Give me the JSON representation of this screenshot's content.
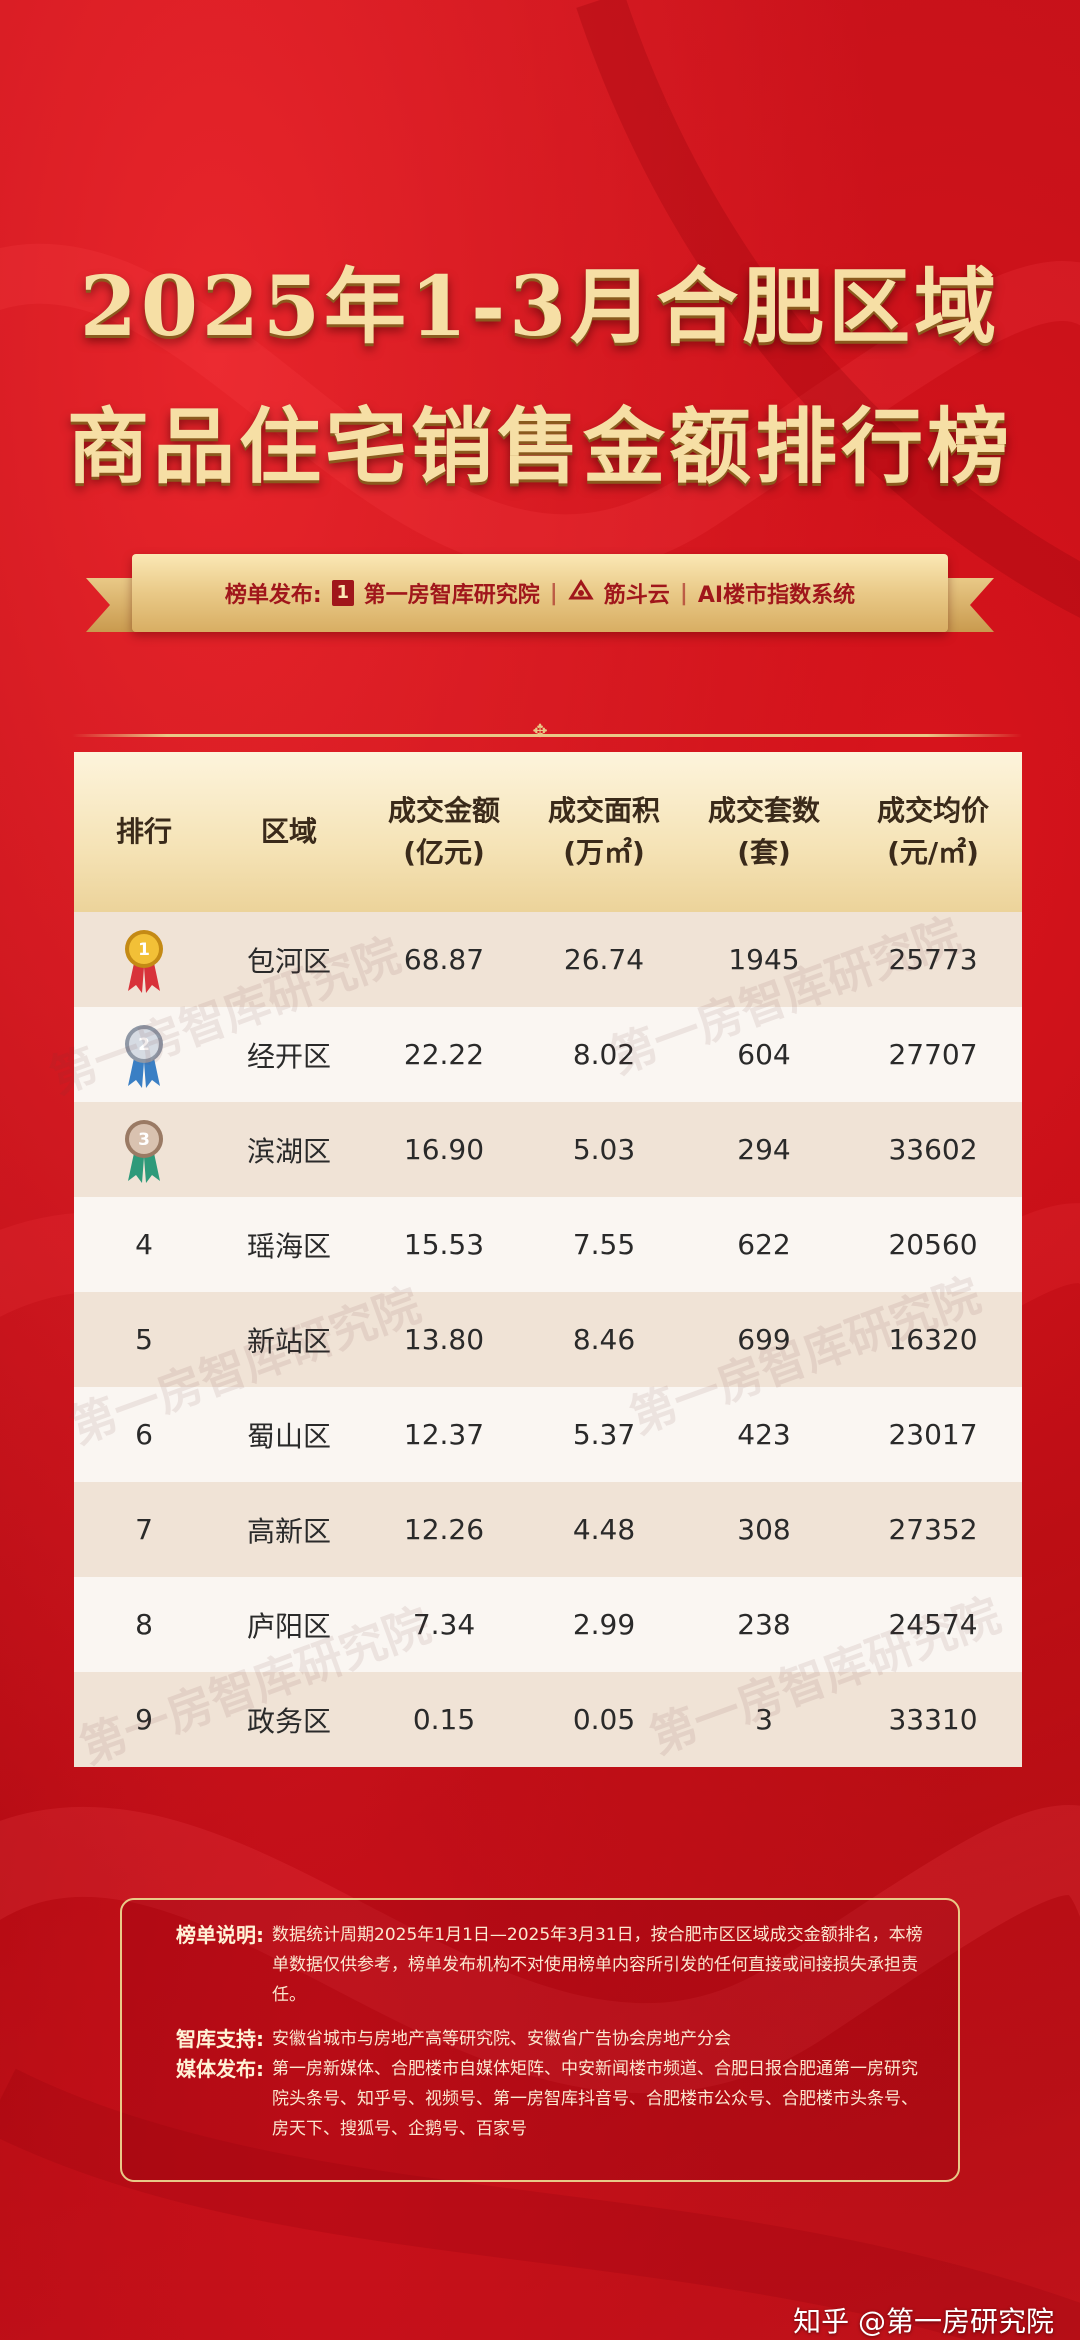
{
  "title": {
    "line1": "2025年1-3月合肥区域",
    "line2": "商品住宅销售金额排行榜"
  },
  "publisher": {
    "prefix": "榜单发布:",
    "logo_glyph": "1",
    "org1": "第一房智库研究院",
    "sep1": "|",
    "org2": "筋斗云",
    "sep2": "|",
    "org3": "AI楼市指数系统"
  },
  "table": {
    "headers": [
      {
        "l1": "排行",
        "l2": ""
      },
      {
        "l1": "区域",
        "l2": ""
      },
      {
        "l1": "成交金额",
        "l2": "(亿元)"
      },
      {
        "l1": "成交面积",
        "l2": "(万㎡)"
      },
      {
        "l1": "成交套数",
        "l2": "(套)"
      },
      {
        "l1": "成交均价",
        "l2": "(元/㎡)"
      }
    ],
    "rows": [
      {
        "rank": "1",
        "medal": "gold-medal-icon",
        "district": "包河区",
        "amount": "68.87",
        "area": "26.74",
        "units": "1945",
        "price": "25773"
      },
      {
        "rank": "2",
        "medal": "silver-medal-icon",
        "district": "经开区",
        "amount": "22.22",
        "area": "8.02",
        "units": "604",
        "price": "27707"
      },
      {
        "rank": "3",
        "medal": "bronze-medal-icon",
        "district": "滨湖区",
        "amount": "16.90",
        "area": "5.03",
        "units": "294",
        "price": "33602"
      },
      {
        "rank": "4",
        "medal": "",
        "district": "瑶海区",
        "amount": "15.53",
        "area": "7.55",
        "units": "622",
        "price": "20560"
      },
      {
        "rank": "5",
        "medal": "",
        "district": "新站区",
        "amount": "13.80",
        "area": "8.46",
        "units": "699",
        "price": "16320"
      },
      {
        "rank": "6",
        "medal": "",
        "district": "蜀山区",
        "amount": "12.37",
        "area": "5.37",
        "units": "423",
        "price": "23017"
      },
      {
        "rank": "7",
        "medal": "",
        "district": "高新区",
        "amount": "12.26",
        "area": "4.48",
        "units": "308",
        "price": "27352"
      },
      {
        "rank": "8",
        "medal": "",
        "district": "庐阳区",
        "amount": "7.34",
        "area": "2.99",
        "units": "238",
        "price": "24574"
      },
      {
        "rank": "9",
        "medal": "",
        "district": "政务区",
        "amount": "0.15",
        "area": "0.05",
        "units": "3",
        "price": "33310"
      }
    ]
  },
  "watermark_text": "第一房智库研究院",
  "notes": {
    "desc_label": "榜单说明:",
    "desc_text": "数据统计周期2025年1月1日—2025年3月31日，按合肥市区区域成交金额排名，本榜单数据仅供参考，榜单发布机构不对使用榜单内容所引发的任何直接或间接损失承担责任。",
    "support_label": "智库支持:",
    "support_text": "安徽省城市与房地产高等研究院、安徽省广告协会房地产分会",
    "media_label": "媒体发布:",
    "media_text": "第一房新媒体、合肥楼市自媒体矩阵、中安新闻楼市频道、合肥日报合肥通第一房研究院头条号、知乎号、视频号、第一房智库抖音号、合肥楼市公众号、合肥楼市头条号、房天下、搜狐号、企鹅号、百家号"
  },
  "credit": "知乎 @第一房研究院",
  "colors": {
    "background": "#c4121b",
    "gold": "#e9c987",
    "header_bg": "#f5e3b6",
    "row_odd": "#f0e3d6",
    "row_even": "#faf6f2"
  }
}
